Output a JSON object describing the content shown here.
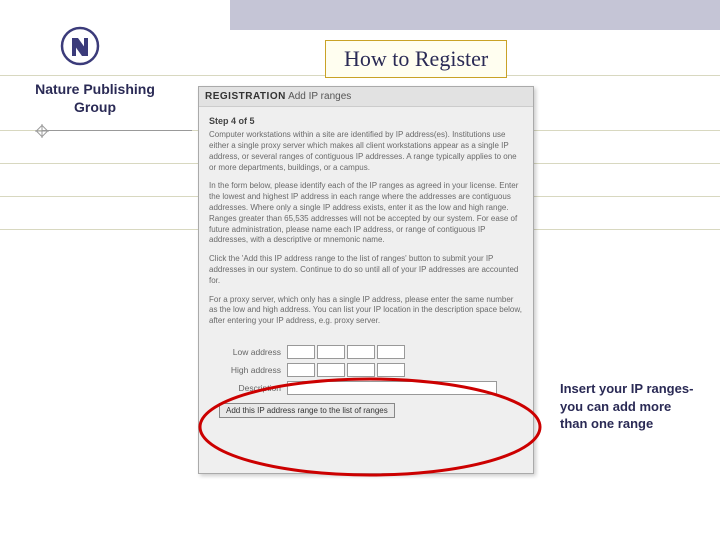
{
  "title": "How to Register",
  "brand": "Nature Publishing Group",
  "callout": "Insert your IP ranges- you can add more than one range",
  "screenshot": {
    "header_bold": "REGISTRATION",
    "header_rest": "Add IP ranges",
    "step": "Step 4 of 5",
    "para1": "Computer workstations within a site are identified by IP address(es). Institutions use either a single proxy server which makes all client workstations appear as a single IP address, or several ranges of contiguous IP addresses. A range typically applies to one or more departments, buildings, or a campus.",
    "para2": "In the form below, please identify each of the IP ranges as agreed in your license. Enter the lowest and highest IP address in each range where the addresses are contiguous addresses. Where only a single IP address exists, enter it as the low and high range. Ranges greater than 65,535 addresses will not be accepted by our system. For ease of future administration, please name each IP address, or range of contiguous IP addresses, with a descriptive or mnemonic name.",
    "para3": "Click the 'Add this IP address range to the list of ranges' button to submit your IP addresses in our system. Continue to do so until all of your IP addresses are accounted for.",
    "para4": "For a proxy server, which only has a single IP address, please enter the same number as the low and high address. You can list your IP location in the description space below, after entering your IP address, e.g. proxy server.",
    "form": {
      "low_label": "Low address",
      "high_label": "High address",
      "desc_label": "Description",
      "button": "Add this IP address range to the list of ranges"
    }
  }
}
